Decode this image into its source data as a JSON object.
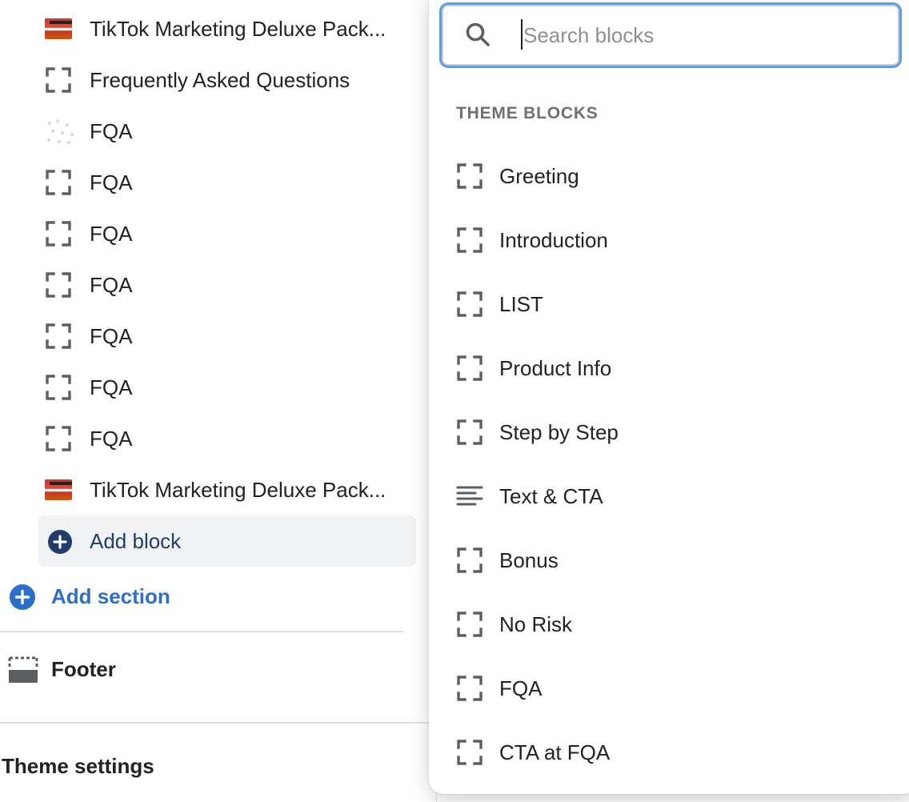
{
  "blocks": [
    {
      "label": "TikTok Marketing Deluxe Pack...",
      "icon": "product-thumbnail-icon"
    },
    {
      "label": "Frequently Asked Questions",
      "icon": "block-frame-icon"
    },
    {
      "label": "FQA",
      "icon": "faded-image-icon"
    },
    {
      "label": "FQA",
      "icon": "block-frame-icon"
    },
    {
      "label": "FQA",
      "icon": "block-frame-icon"
    },
    {
      "label": "FQA",
      "icon": "block-frame-icon"
    },
    {
      "label": "FQA",
      "icon": "block-frame-icon"
    },
    {
      "label": "FQA",
      "icon": "block-frame-icon"
    },
    {
      "label": "FQA",
      "icon": "block-frame-icon"
    },
    {
      "label": "TikTok Marketing Deluxe Pack...",
      "icon": "product-thumbnail-icon"
    }
  ],
  "add_block": {
    "label": "Add block",
    "icon": "plus-circle-icon"
  },
  "add_section": {
    "label": "Add section",
    "icon": "plus-circle-icon"
  },
  "footer": {
    "label": "Footer",
    "icon": "footer-section-icon"
  },
  "theme_settings": {
    "label": "Theme settings"
  },
  "popover": {
    "search": {
      "placeholder": "Search blocks",
      "value": "",
      "icon": "search-icon"
    },
    "section_heading": "THEME BLOCKS",
    "items": [
      {
        "label": "Greeting",
        "icon": "block-frame-icon"
      },
      {
        "label": "Introduction",
        "icon": "block-frame-icon"
      },
      {
        "label": "LIST",
        "icon": "block-frame-icon"
      },
      {
        "label": "Product Info",
        "icon": "block-frame-icon"
      },
      {
        "label": "Step by Step",
        "icon": "block-frame-icon"
      },
      {
        "label": "Text & CTA",
        "icon": "text-lines-icon"
      },
      {
        "label": "Bonus",
        "icon": "block-frame-icon"
      },
      {
        "label": "No Risk",
        "icon": "block-frame-icon"
      },
      {
        "label": "FQA",
        "icon": "block-frame-icon"
      },
      {
        "label": "CTA at FQA",
        "icon": "block-frame-icon"
      }
    ]
  },
  "colors": {
    "accent": "#2c6ecb",
    "focus_ring": "#5a9ee8",
    "text": "#202223",
    "muted": "#6d7175"
  }
}
